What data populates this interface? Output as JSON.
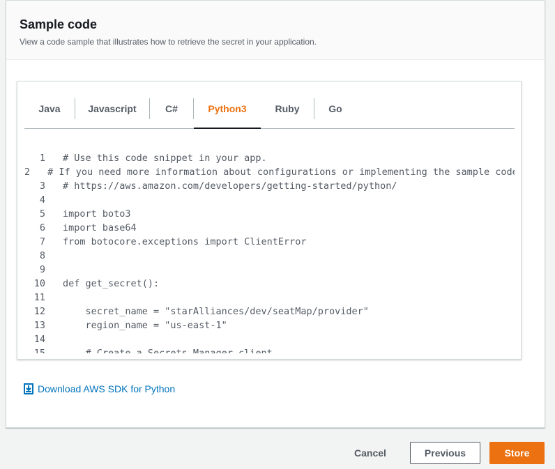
{
  "header": {
    "title": "Sample code",
    "description": "View a code sample that illustrates how to retrieve the secret in your application."
  },
  "tabs": [
    {
      "label": "Java",
      "active": false
    },
    {
      "label": "Javascript",
      "active": false
    },
    {
      "label": "C#",
      "active": false
    },
    {
      "label": "Python3",
      "active": true
    },
    {
      "label": "Ruby",
      "active": false
    },
    {
      "label": "Go",
      "active": false
    }
  ],
  "code": {
    "lines": [
      {
        "n": "1",
        "text": "# Use this code snippet in your app."
      },
      {
        "n": "2",
        "text": "# If you need more information about configurations or implementing the sample code"
      },
      {
        "n": "3",
        "text": "# https://aws.amazon.com/developers/getting-started/python/"
      },
      {
        "n": "4",
        "text": ""
      },
      {
        "n": "5",
        "text": "import boto3"
      },
      {
        "n": "6",
        "text": "import base64"
      },
      {
        "n": "7",
        "text": "from botocore.exceptions import ClientError"
      },
      {
        "n": "8",
        "text": ""
      },
      {
        "n": "9",
        "text": ""
      },
      {
        "n": "10",
        "text": "def get_secret():"
      },
      {
        "n": "11",
        "text": ""
      },
      {
        "n": "12",
        "text": "    secret_name = \"starAlliances/dev/seatMap/provider\""
      },
      {
        "n": "13",
        "text": "    region_name = \"us-east-1\""
      },
      {
        "n": "14",
        "text": ""
      },
      {
        "n": "15",
        "text": "    # Create a Secrets Manager client"
      }
    ]
  },
  "download": {
    "label": "Download AWS SDK for Python",
    "icon": "download-icon"
  },
  "footer": {
    "cancel_label": "Cancel",
    "previous_label": "Previous",
    "store_label": "Store"
  },
  "colors": {
    "accent": "#ec7211",
    "link": "#0073bb",
    "text_secondary": "#545b64"
  }
}
